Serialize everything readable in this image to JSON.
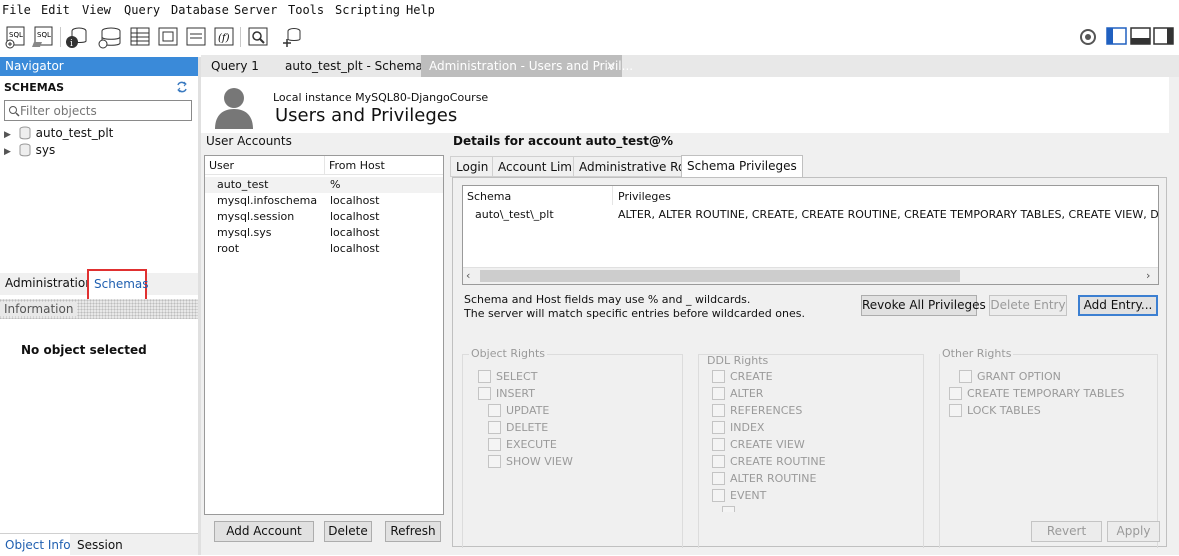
{
  "menu": [
    "File",
    "Edit",
    "View",
    "Query",
    "Database",
    "Server",
    "Tools",
    "Scripting",
    "Help"
  ],
  "navigator": {
    "title": "Navigator",
    "section": "SCHEMAS",
    "filter_placeholder": "Filter objects",
    "schemas": [
      "auto_test_plt",
      "sys"
    ],
    "tabs": [
      "Administration",
      "Schemas"
    ],
    "info_title": "Information",
    "no_object": "No object selected",
    "bottom_tabs": [
      "Object Info",
      "Session"
    ]
  },
  "doc_tabs": [
    "Query 1",
    "auto_test_plt - Schema",
    "Administration - Users and Privil..."
  ],
  "header": {
    "instance": "Local instance MySQL80-DjangoCourse",
    "title": "Users and Privileges"
  },
  "accounts": {
    "label": "User Accounts",
    "columns": [
      "User",
      "From Host"
    ],
    "rows": [
      {
        "user": "auto_test",
        "host": "%"
      },
      {
        "user": "mysql.infoschema",
        "host": "localhost"
      },
      {
        "user": "mysql.session",
        "host": "localhost"
      },
      {
        "user": "mysql.sys",
        "host": "localhost"
      },
      {
        "user": "root",
        "host": "localhost"
      }
    ],
    "buttons": [
      "Add Account",
      "Delete",
      "Refresh"
    ]
  },
  "details": {
    "title": "Details for account auto_test@%",
    "tabs": [
      "Login",
      "Account Limits",
      "Administrative Roles",
      "Schema Privileges"
    ],
    "columns": [
      "Schema",
      "Privileges"
    ],
    "row": {
      "schema": "auto\\_test\\_plt",
      "privileges": "ALTER, ALTER ROUTINE, CREATE, CREATE ROUTINE, CREATE TEMPORARY TABLES, CREATE VIEW, DELETE"
    },
    "hint1": "Schema and Host fields may use % and _ wildcards.",
    "hint2": "The server will match specific entries before wildcarded ones.",
    "buttons": {
      "revoke": "Revoke All Privileges",
      "delete": "Delete Entry",
      "add": "Add Entry..."
    }
  },
  "object_rights": {
    "title": "Object Rights",
    "items": [
      "SELECT",
      "INSERT",
      "UPDATE",
      "DELETE",
      "EXECUTE",
      "SHOW VIEW"
    ]
  },
  "ddl_rights": {
    "title": "DDL Rights",
    "items": [
      "CREATE",
      "ALTER",
      "REFERENCES",
      "INDEX",
      "CREATE VIEW",
      "CREATE ROUTINE",
      "ALTER ROUTINE",
      "EVENT"
    ]
  },
  "other_rights": {
    "title": "Other Rights",
    "items": [
      "GRANT OPTION",
      "CREATE TEMPORARY TABLES",
      "LOCK TABLES"
    ]
  },
  "footer": {
    "revert": "Revert",
    "apply": "Apply"
  },
  "colors": {
    "accent": "#3a8ad9",
    "highlight": "#e03030"
  }
}
